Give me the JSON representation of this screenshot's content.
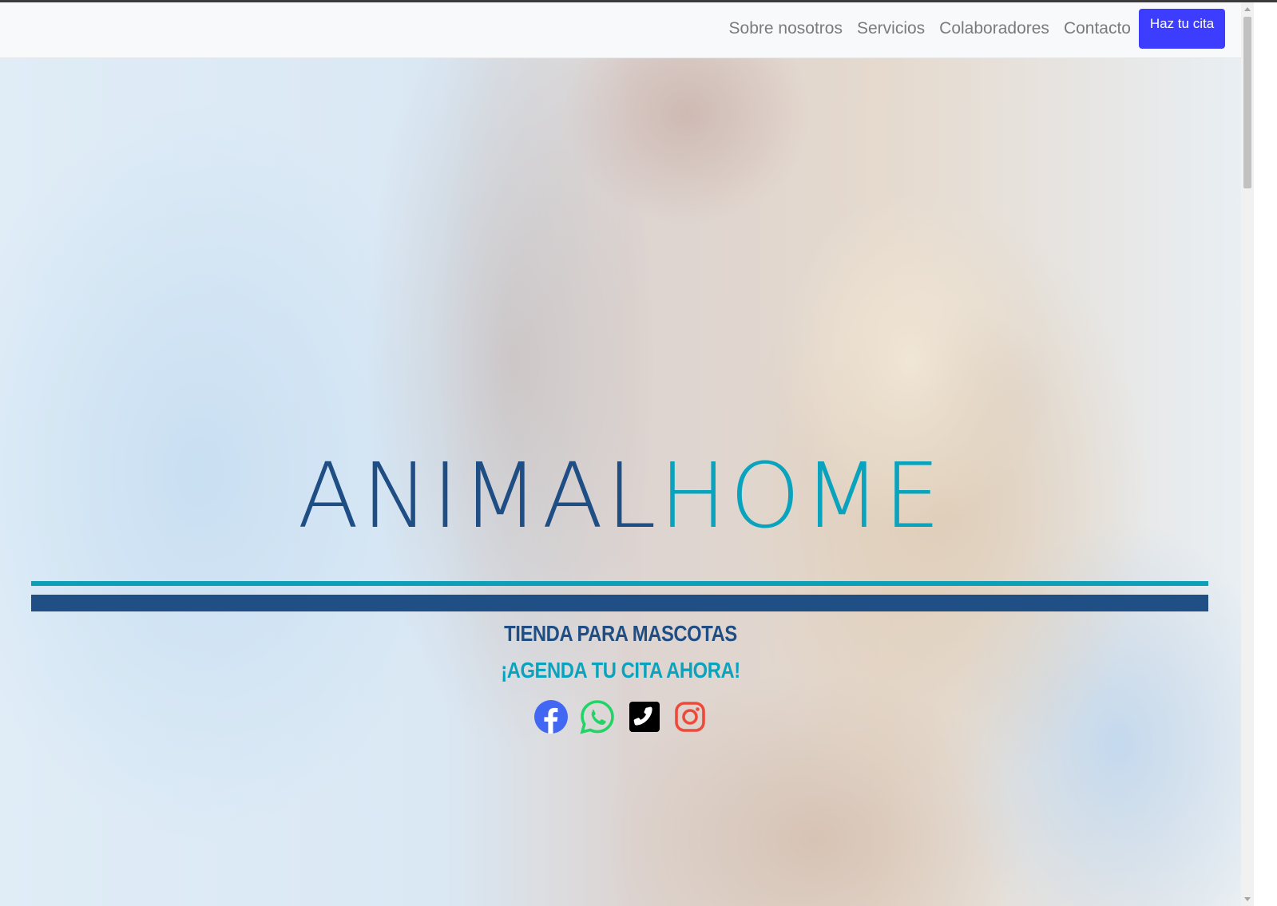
{
  "nav": {
    "links": [
      "Sobre nosotros",
      "Servicios",
      "Colaboradores",
      "Contacto"
    ],
    "cta_label": "Haz tu cita"
  },
  "hero": {
    "logo_part1": "ANIMAL",
    "logo_part2": "HOME",
    "tagline": "TIENDA PARA MASCOTAS",
    "cta_text": "¡AGENDA TU CITA AHORA!",
    "socials": [
      "facebook-icon",
      "whatsapp-icon",
      "phone-icon",
      "instagram-icon"
    ]
  },
  "colors": {
    "brand_dark": "#1f4e85",
    "brand_teal": "#0aa3bd",
    "cta_button": "#3d3dff",
    "facebook": "#4267f2",
    "whatsapp": "#22d366",
    "phone": "#000000",
    "instagram": "#ee4a3a"
  }
}
